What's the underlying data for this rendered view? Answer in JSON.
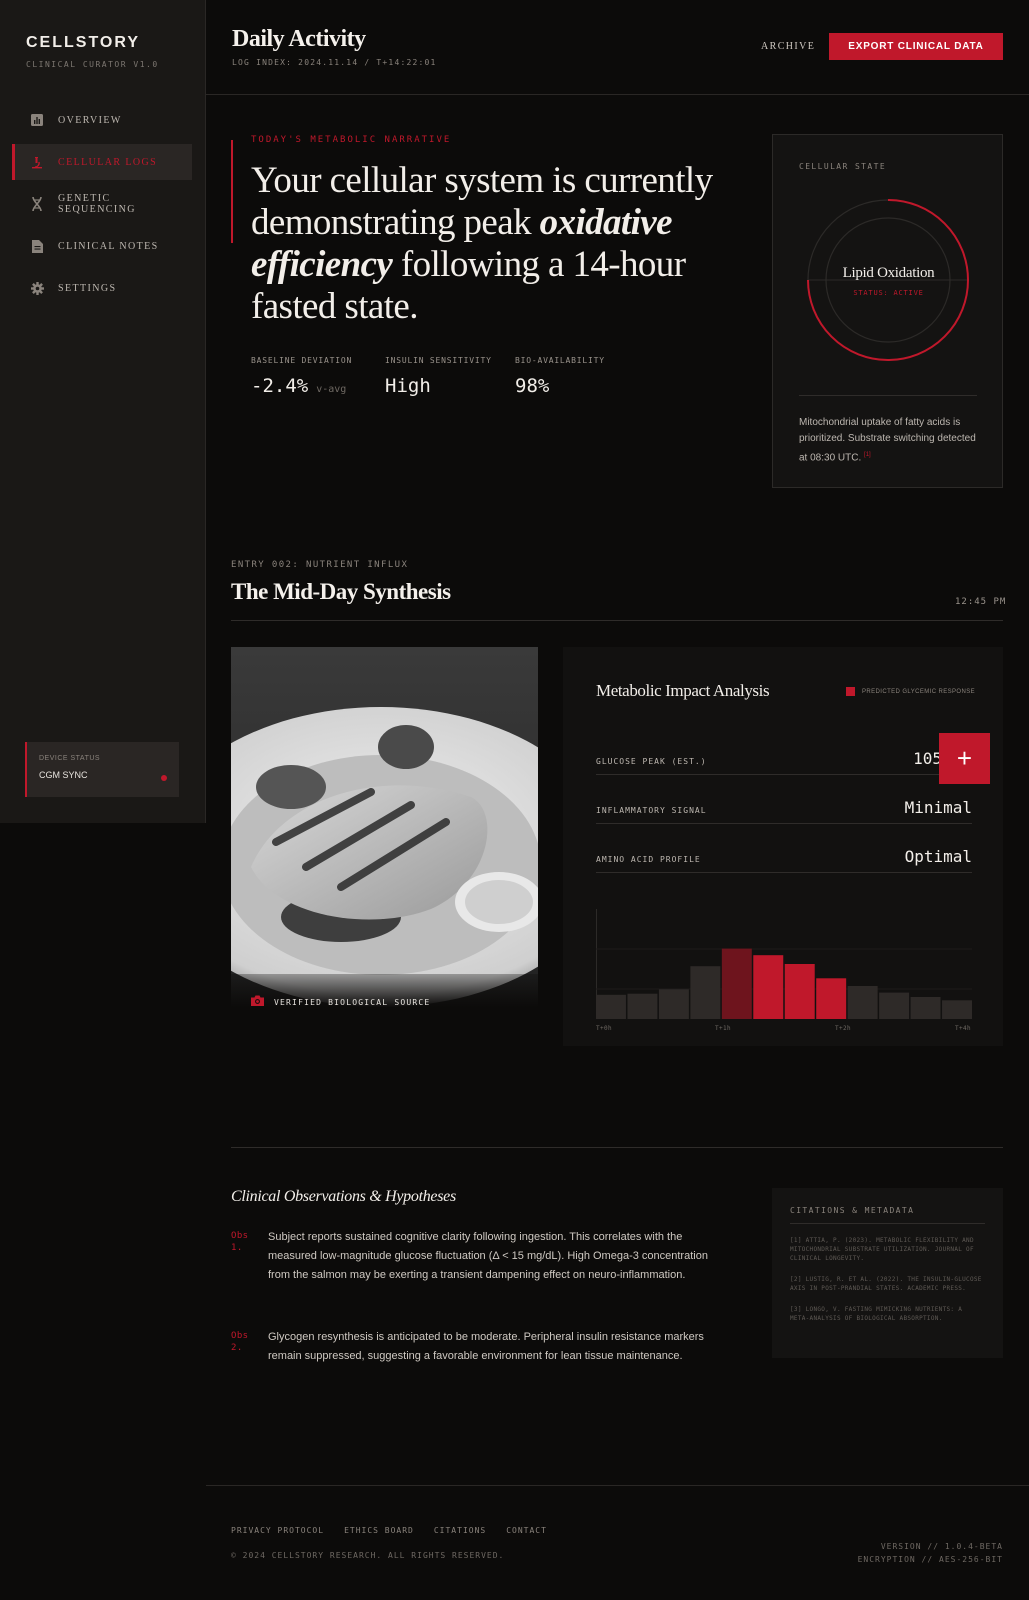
{
  "sidebar": {
    "brand": "CELLSTORY",
    "brand_sub": "CLINICAL CURATOR V1.0",
    "items": [
      {
        "label": "OVERVIEW",
        "icon": "chart-icon"
      },
      {
        "label": "CELLULAR LOGS",
        "icon": "microscope-icon",
        "active": true
      },
      {
        "label": "GENETIC SEQUENCING",
        "icon": "dna-icon"
      },
      {
        "label": "CLINICAL NOTES",
        "icon": "document-icon"
      },
      {
        "label": "SETTINGS",
        "icon": "gear-icon"
      }
    ],
    "device": {
      "label": "DEVICE STATUS",
      "value": "CGM SYNC"
    }
  },
  "header": {
    "title": "Daily Activity",
    "sub": "LOG INDEX: 2024.11.14 / T+14:22:01",
    "archive": "ARCHIVE",
    "export": "EXPORT CLINICAL DATA"
  },
  "narrative": {
    "label": "TODAY'S METABOLIC NARRATIVE",
    "text_1": "Your cellular system is currently demonstrating peak ",
    "text_em_1": "oxidative",
    "text_em_2": "efficiency",
    "text_2": " following a 14-hour fasted state.",
    "metrics": [
      {
        "label": "BASELINE DEVIATION",
        "value": "-2.4%",
        "suffix": "v-avg"
      },
      {
        "label": "INSULIN SENSITIVITY",
        "value": "High"
      },
      {
        "label": "BIO-AVAILABILITY",
        "value": "98%"
      }
    ]
  },
  "state": {
    "label": "CELLULAR STATE",
    "name": "Lipid Oxidation",
    "status": "STATUS: ACTIVE",
    "text": "Mitochondrial uptake of fatty acids is prioritized. Substrate switching detected at 08:30 UTC.",
    "ref": "[1]"
  },
  "entry": {
    "label": "ENTRY 002: NUTRIENT INFLUX",
    "title": "The Mid-Day Synthesis",
    "time": "12:45 PM",
    "photo_caption": "VERIFIED BIOLOGICAL SOURCE"
  },
  "impact": {
    "title": "Metabolic Impact Analysis",
    "legend": "PREDICTED GLYCEMIC RESPONSE",
    "rows": [
      {
        "label": "GLUCOSE PEAK (EST.)",
        "value": "105"
      },
      {
        "label": "INFLAMMATORY SIGNAL",
        "value": "Minimal"
      },
      {
        "label": "AMINO ACID PROFILE",
        "value": "Optimal"
      }
    ],
    "fab": "+"
  },
  "chart_data": {
    "type": "bar",
    "categories": [
      "1",
      "2",
      "3",
      "4",
      "5",
      "6",
      "7",
      "8",
      "9",
      "10",
      "11",
      "12"
    ],
    "values": [
      22,
      23,
      27,
      48,
      64,
      58,
      50,
      37,
      30,
      24,
      20,
      17
    ],
    "highlight": [
      4,
      5,
      6,
      7
    ],
    "ylim": [
      0,
      100
    ],
    "tick_labels": [
      "T+0h",
      "T+1h",
      "T+2h",
      "T+4h"
    ],
    "colors": {
      "base": "#2e2a28",
      "dim": "#6e141d",
      "accent": "#c0182b"
    }
  },
  "observations": {
    "title": "Clinical Observations & Hypotheses",
    "items": [
      {
        "num": "Obs 1.",
        "text": "Subject reports sustained cognitive clarity following ingestion. This correlates with the measured low-magnitude glucose fluctuation (Δ < 15 mg/dL). High Omega-3 concentration from the salmon may be exerting a transient dampening effect on neuro-inflammation."
      },
      {
        "num": "Obs 2.",
        "text": "Glycogen resynthesis is anticipated to be moderate. Peripheral insulin resistance markers remain suppressed, suggesting a favorable environment for lean tissue maintenance."
      }
    ]
  },
  "citations": {
    "label": "CITATIONS & METADATA",
    "items": [
      "[1] ATTIA, P. (2023). METABOLIC FLEXIBILITY AND MITOCHONDRIAL SUBSTRATE UTILIZATION. JOURNAL OF CLINICAL LONGEVITY.",
      "[2] LUSTIG, R. ET AL. (2022). THE INSULIN-GLUCOSE AXIS IN POST-PRANDIAL STATES. ACADEMIC PRESS.",
      "[3] LONGO, V. FASTING MIMICKING NUTRIENTS: A META-ANALYSIS OF BIOLOGICAL ABSORPTION."
    ]
  },
  "footer": {
    "links": [
      "PRIVACY PROTOCOL",
      "ETHICS BOARD",
      "CITATIONS",
      "CONTACT"
    ],
    "copyright": "© 2024 CELLSTORY RESEARCH. ALL RIGHTS RESERVED.",
    "version": "VERSION // 1.0.4-BETA",
    "encryption": "ENCRYPTION // AES-256-BIT"
  },
  "colors": {
    "accent": "#c0182b",
    "bg": "#0c0b0a",
    "sidebar": "#1a1816"
  }
}
